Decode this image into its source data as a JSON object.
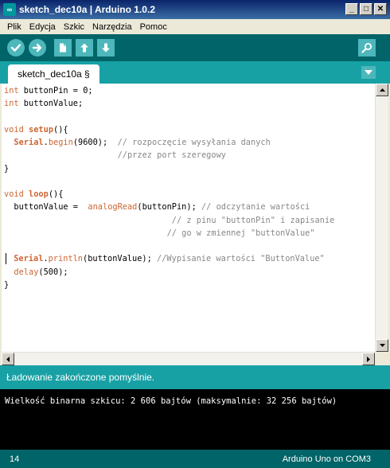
{
  "window": {
    "title": "sketch_dec10a | Arduino 1.0.2",
    "app_icon_text": "∞",
    "minimize": "_",
    "maximize": "□",
    "close": "✕"
  },
  "menu": {
    "items": [
      {
        "label": "Plik"
      },
      {
        "label": "Edycja"
      },
      {
        "label": "Szkic"
      },
      {
        "label": "Narzędzia"
      },
      {
        "label": "Pomoc"
      }
    ]
  },
  "toolbar": {
    "buttons": [
      {
        "name": "verify",
        "icon": "check-icon"
      },
      {
        "name": "upload",
        "icon": "arrow-right-icon"
      },
      {
        "name": "new",
        "icon": "new-file-icon"
      },
      {
        "name": "open",
        "icon": "arrow-up-icon"
      },
      {
        "name": "save",
        "icon": "arrow-down-icon"
      },
      {
        "name": "serial-monitor",
        "icon": "magnifier-icon"
      }
    ]
  },
  "tabs": {
    "active": "sketch_dec10a §"
  },
  "editor": {
    "lines": [
      "int buttonPin = 0;",
      "int buttonValue;",
      "",
      "void setup(){",
      "  Serial.begin(9600);  // rozpoczęcie wysyłania danych",
      "                       //przez port szeregowy",
      "}",
      "",
      "void loop(){",
      "  buttonValue =  analogRead(buttonPin); // odczytanie wartości",
      "                                  // z pinu \"buttonPin\" i zapisanie",
      "                                 // go w zmiennej \"buttonValue\"",
      "",
      "  Serial.println(buttonValue); //Wypisanie wartości \"ButtonValue\"",
      "  delay(500);",
      "}"
    ]
  },
  "status": {
    "message": "Ładowanie zakończone pomyślnie."
  },
  "console": {
    "text": "Wielkość binarna szkicu: 2 606 bajtów (maksymalnie: 32 256 bajtów)"
  },
  "footer": {
    "line_number": "14",
    "board": "Arduino Uno on COM3"
  },
  "colors": {
    "toolbar_bg": "#006468",
    "tabstrip_bg": "#17a1a5",
    "button_bg": "#4db7bb",
    "keyword": "#cc6633",
    "comment": "#888888",
    "console_bg": "#000000"
  }
}
